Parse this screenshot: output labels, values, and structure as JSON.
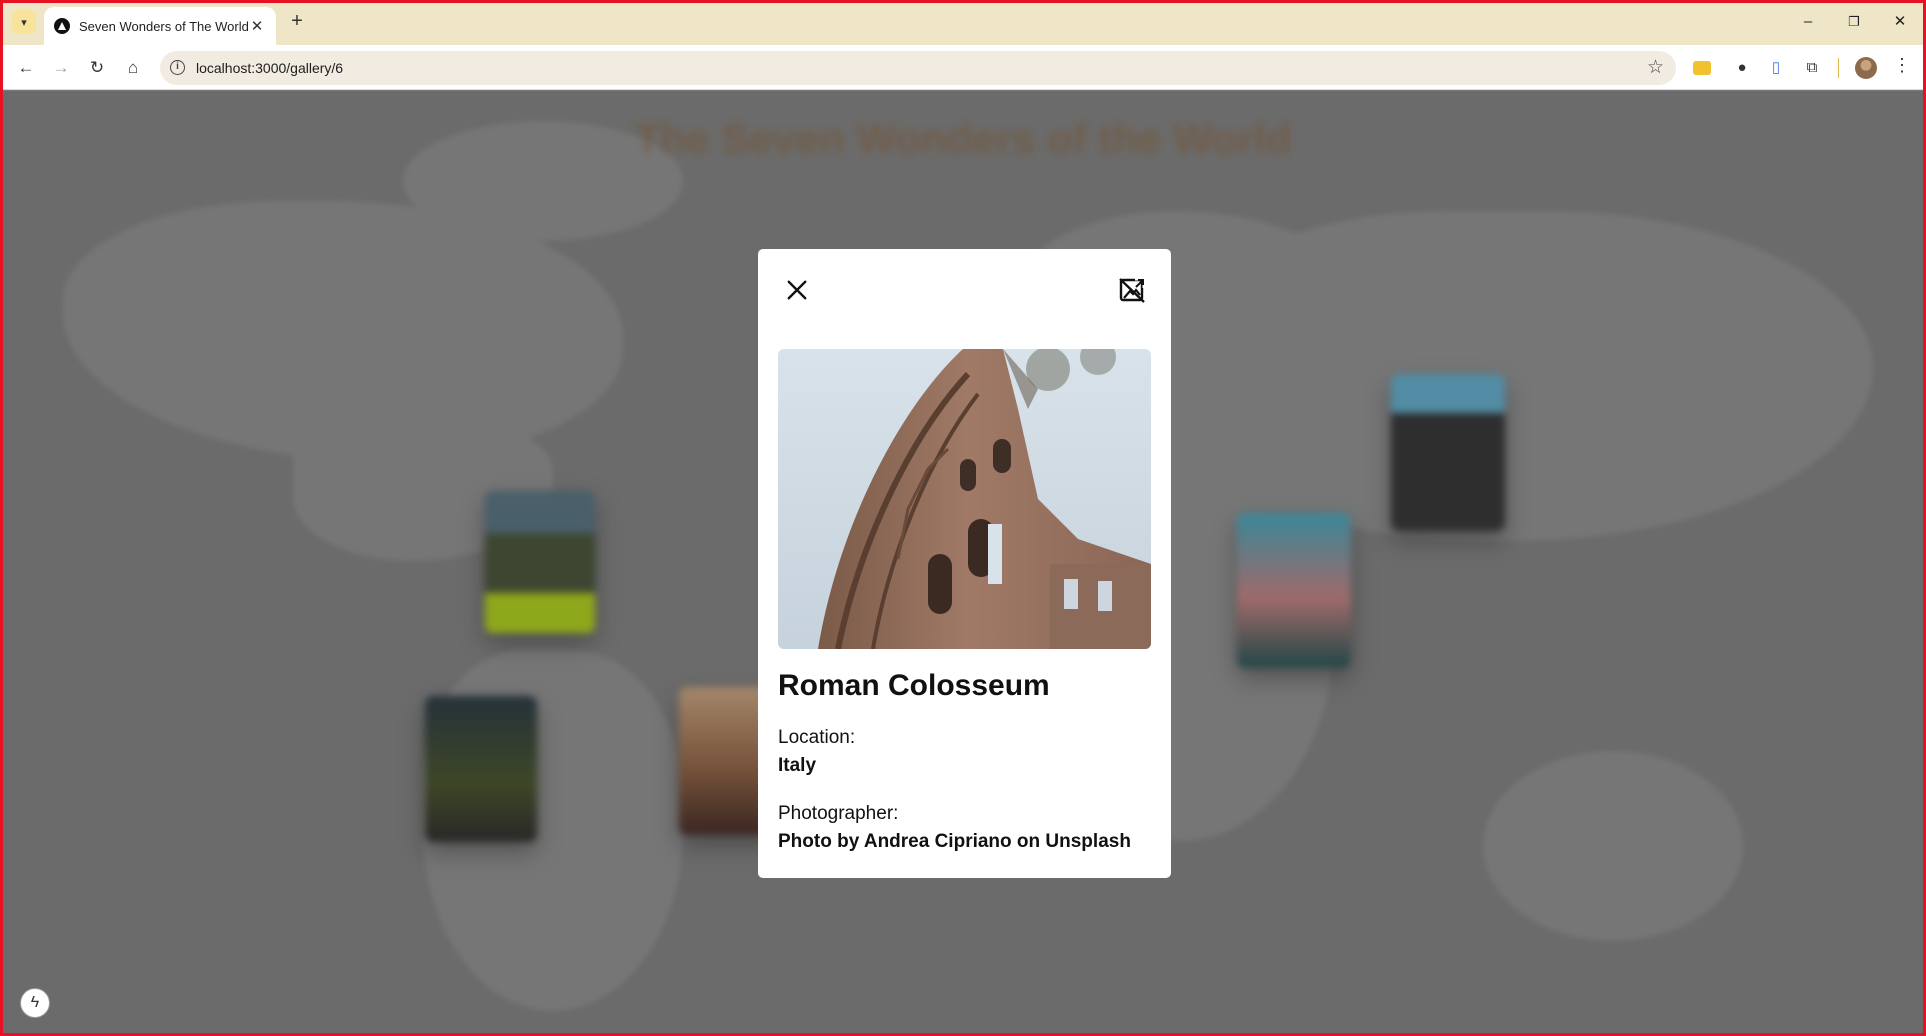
{
  "browser": {
    "tab_title": "Seven Wonders of The World",
    "url": "localhost:3000/gallery/6",
    "tab_menu_icon": "chevron-down-icon",
    "new_tab_label": "+",
    "minimize_label": "–",
    "restore_label": "❐",
    "close_label": "✕"
  },
  "page": {
    "heading": "The Seven Wonders of the World"
  },
  "modal": {
    "title": "Roman Colosseum",
    "location_label": "Location:",
    "location_value": "Italy",
    "photographer_label": "Photographer:",
    "photographer_value": "Photo by Andrea Cipriano on Unsplash",
    "image_alt": "Roman Colosseum"
  },
  "colors": {
    "frame": "#e81123",
    "tabbar": "#efe6c7",
    "heading": "#8a5a2a",
    "overlay": "#7b7b7b",
    "modal_bg": "#ffffff"
  }
}
